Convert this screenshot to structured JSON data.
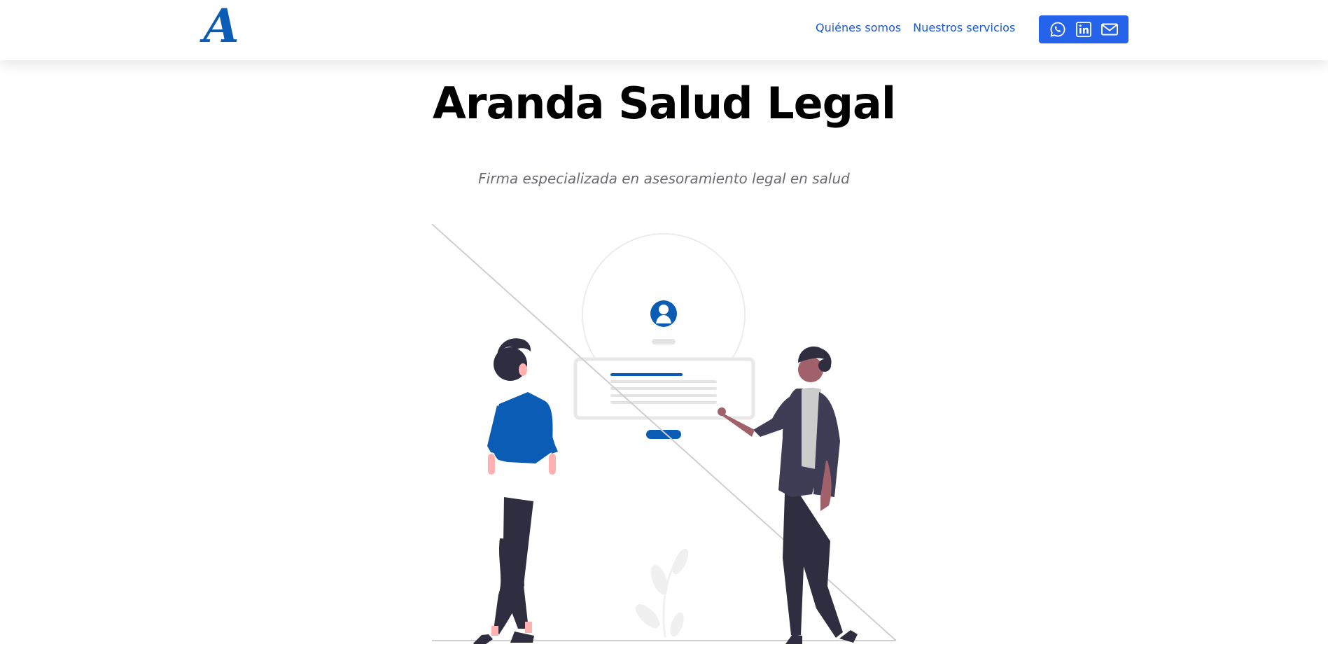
{
  "header": {
    "logo_text": "A",
    "nav": [
      {
        "label": "Quiénes somos"
      },
      {
        "label": "Nuestros servicios"
      }
    ],
    "social": [
      "whatsapp-icon",
      "linkedin-icon",
      "mail-icon"
    ],
    "accent_color": "#2563eb",
    "link_color": "#1a57d6"
  },
  "hero": {
    "title": "Aranda Salud Legal",
    "subtitle": "Firma especializada en asesoramiento legal en salud"
  },
  "illustration": {
    "primary_color": "#0a5cb5",
    "skin_color": "#ffb1b1",
    "dark_color": "#2f2e41"
  }
}
